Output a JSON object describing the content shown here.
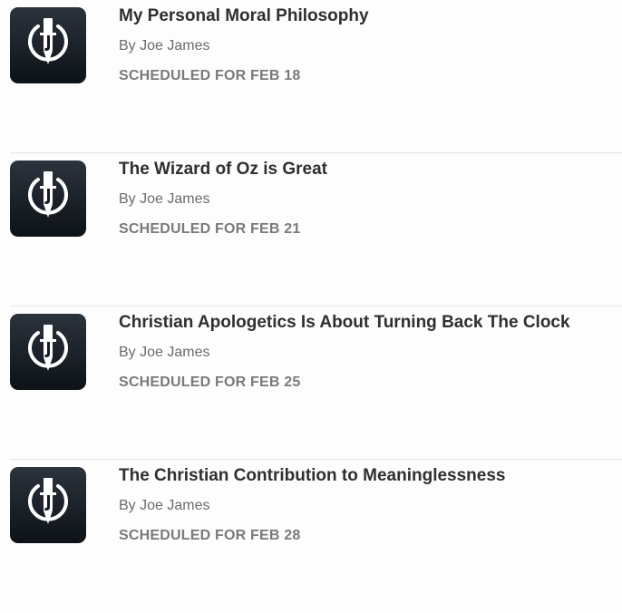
{
  "posts": [
    {
      "title": "My Personal Moral Philosophy",
      "author": "By Joe James",
      "status": "SCHEDULED FOR FEB 18",
      "thumbnail_icon": "sword-j-logo-icon"
    },
    {
      "title": "The Wizard of Oz is Great",
      "author": "By Joe James",
      "status": "SCHEDULED FOR FEB 21",
      "thumbnail_icon": "sword-j-logo-icon"
    },
    {
      "title": "Christian Apologetics Is About Turning Back The Clock",
      "author": "By Joe James",
      "status": "SCHEDULED FOR FEB 25",
      "thumbnail_icon": "sword-j-logo-icon"
    },
    {
      "title": "The Christian Contribution to Meaninglessness",
      "author": "By Joe James",
      "status": "SCHEDULED FOR FEB 28",
      "thumbnail_icon": "sword-j-logo-icon"
    }
  ],
  "colors": {
    "thumb_top": "#2b333d",
    "thumb_bottom": "#0d1217",
    "title": "#2f2f2f",
    "byline": "#6b6b6b",
    "status": "#7a7a7a",
    "divider": "#e4e4e4"
  }
}
